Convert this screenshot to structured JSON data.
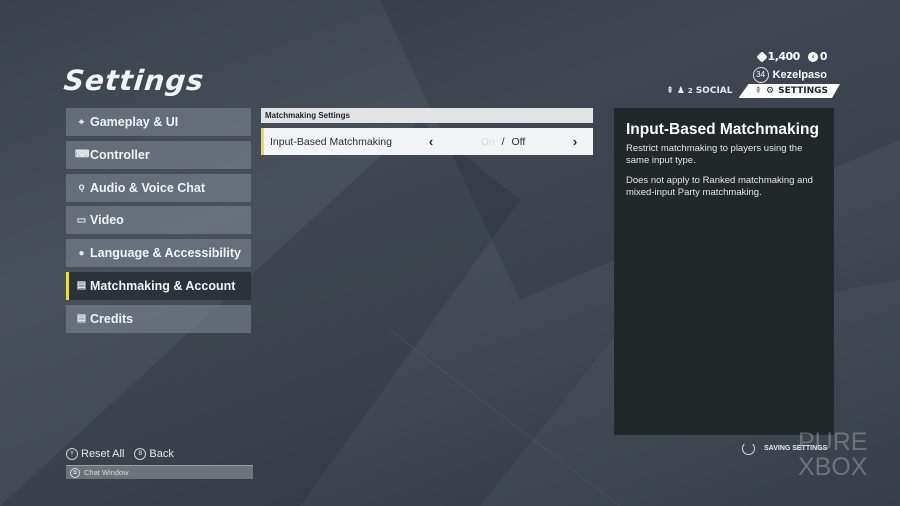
{
  "page": {
    "title": "Settings"
  },
  "header": {
    "currency": [
      {
        "icon": "credits-icon",
        "value": "1,400"
      },
      {
        "icon": "xp-token-icon",
        "value": "0"
      }
    ],
    "player": {
      "level": "34",
      "name": "Kezelpaso"
    },
    "tabs": {
      "social_count": "2",
      "social_label": "SOCIAL",
      "settings_label": "SETTINGS"
    }
  },
  "sidebar": {
    "items": [
      {
        "label": "Gameplay & UI",
        "icon": "crosshair-icon",
        "glyph": "⌖"
      },
      {
        "label": "Controller",
        "icon": "gamepad-icon",
        "glyph": "🎮"
      },
      {
        "label": "Audio & Voice Chat",
        "icon": "microphone-icon",
        "glyph": "🎙"
      },
      {
        "label": "Video",
        "icon": "monitor-icon",
        "glyph": "▭"
      },
      {
        "label": "Language & Accessibility",
        "icon": "globe-icon",
        "glyph": "●"
      },
      {
        "label": "Matchmaking & Account",
        "icon": "document-icon",
        "glyph": "▤",
        "active": true
      },
      {
        "label": "Credits",
        "icon": "document-icon",
        "glyph": "▤"
      }
    ]
  },
  "main": {
    "section_header": "Matchmaking Settings",
    "settings": [
      {
        "label": "Input-Based Matchmaking",
        "options": [
          "On",
          "Off"
        ],
        "selected": "Off",
        "separator": "/"
      }
    ]
  },
  "description": {
    "title": "Input-Based Matchmaking",
    "paragraphs": [
      "Restrict matchmaking to players using the same input type.",
      "Does not apply to Ranked matchmaking and mixed-input Party matchmaking."
    ]
  },
  "footer": {
    "reset_glyph": "Y",
    "reset_label": "Reset All",
    "back_glyph": "B",
    "back_label": "Back",
    "chat_glyph": "⧉",
    "chat_label": "Chat Window"
  },
  "status": {
    "saving_label": "SAVING SETTINGS"
  },
  "watermark": {
    "line1": "PURE",
    "line2": "XBOX"
  },
  "colors": {
    "accent_yellow": "#e6e336",
    "panel_dark": "#22272a",
    "row_light": "#f3f4f5"
  }
}
